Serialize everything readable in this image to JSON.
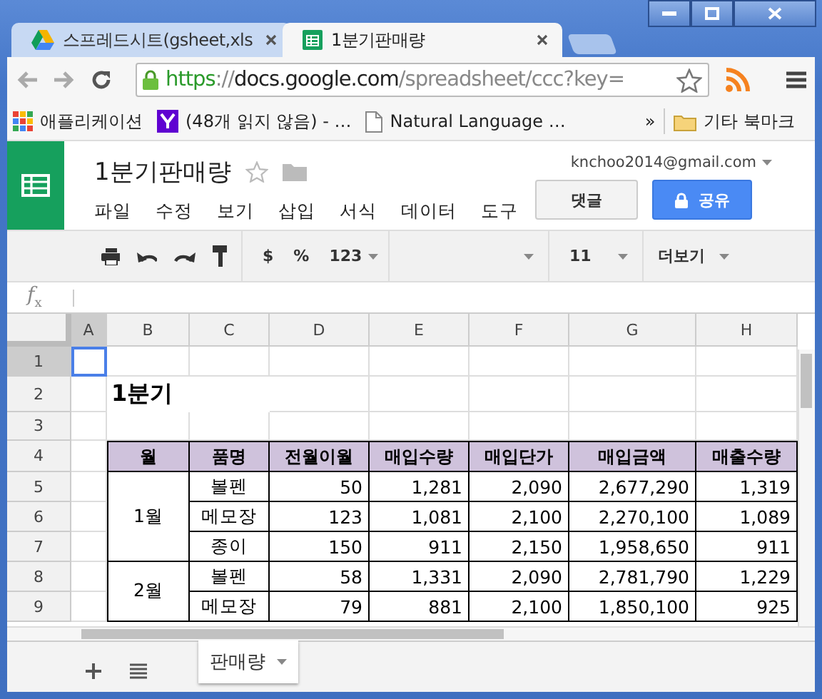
{
  "browser": {
    "tabs": [
      {
        "title": "스프레드시트(gsheet,xls",
        "selected": false
      },
      {
        "title": "1분기판매량",
        "selected": true
      }
    ],
    "address": {
      "scheme": "https",
      "separator": "://",
      "host": "docs.google.com",
      "path": "/spreadsheet/ccc?key="
    },
    "bookmarks": [
      {
        "label": "애플리케이션"
      },
      {
        "label": "(48개 읽지 않음) - …"
      },
      {
        "label": "Natural Language …"
      }
    ],
    "bookmarks_more": "»",
    "other_bookmarks": "기타 북마크"
  },
  "doc": {
    "title": "1분기판매량",
    "account": "knchoo2014@gmail.com",
    "menus": [
      "파일",
      "수정",
      "보기",
      "삽입",
      "서식",
      "데이터",
      "도구"
    ],
    "comment_button": "댓글",
    "share_button": "공유"
  },
  "toolbar": {
    "currency": "$",
    "percent": "%",
    "number_format": "123",
    "font_size": "11",
    "more": "더보기"
  },
  "formula_bar": {
    "label": "f$_{x}$"
  },
  "sheet": {
    "columns": [
      {
        "label": "A",
        "selected": true
      },
      {
        "label": "B",
        "selected": false
      },
      {
        "label": "C",
        "selected": false
      },
      {
        "label": "D",
        "selected": false
      },
      {
        "label": "E",
        "selected": false
      },
      {
        "label": "F",
        "selected": false
      },
      {
        "label": "G",
        "selected": false
      },
      {
        "label": "H",
        "selected": false
      }
    ],
    "rows": [
      {
        "label": "1",
        "selected": true
      },
      {
        "label": "2",
        "selected": false
      },
      {
        "label": "3",
        "selected": false
      },
      {
        "label": "4",
        "selected": false
      },
      {
        "label": "5",
        "selected": false
      },
      {
        "label": "6",
        "selected": false
      },
      {
        "label": "7",
        "selected": false
      },
      {
        "label": "8",
        "selected": false
      },
      {
        "label": "9",
        "selected": false
      }
    ],
    "title": "1분기",
    "table_header": [
      "월",
      "품명",
      "전월이월",
      "매입수량",
      "매입단가",
      "매입금액",
      "매출수량"
    ],
    "groups": [
      {
        "month": "1월",
        "rows": [
          [
            "볼펜",
            "50",
            "1,281",
            "2,090",
            "2,677,290",
            "1,319"
          ],
          [
            "메모장",
            "123",
            "1,081",
            "2,100",
            "2,270,100",
            "1,089"
          ],
          [
            "종이",
            "150",
            "911",
            "2,150",
            "1,958,650",
            "911"
          ]
        ]
      },
      {
        "month": "2월",
        "rows": [
          [
            "볼펜",
            "58",
            "1,331",
            "2,090",
            "2,781,790",
            "1,229"
          ],
          [
            "메모장",
            "79",
            "881",
            "2,100",
            "1,850,100",
            "925"
          ]
        ]
      }
    ]
  },
  "sheet_tabs": [
    {
      "label": "판매량",
      "selected": true
    }
  ]
}
